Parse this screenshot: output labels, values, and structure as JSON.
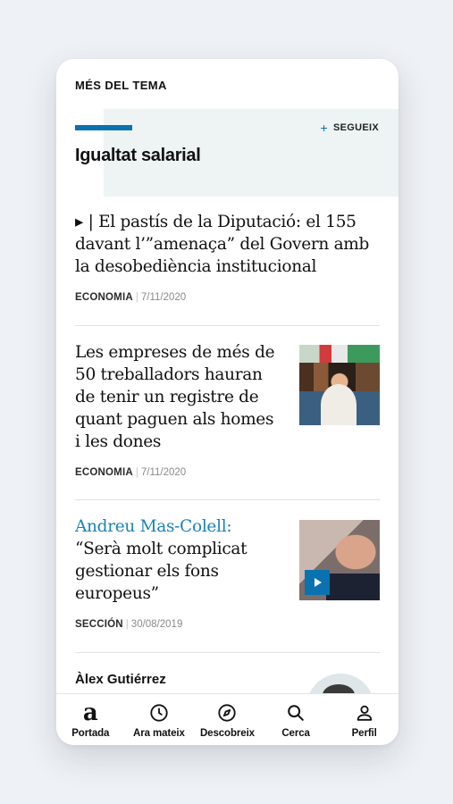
{
  "section": {
    "label": "MÉS DEL TEMA"
  },
  "topic": {
    "title": "Igualtat salarial",
    "follow_label": "SEGUEIX",
    "follow_icon": "plus-icon",
    "accent": "#0a72ae"
  },
  "articles": [
    {
      "headline_prefix": "▸ | ",
      "headline": "El pastís de la Diputació: el 155 davant l’”amenaça” del Govern amb la desobediència institucional",
      "category": "ECONOMIA",
      "date": "7/11/2020"
    },
    {
      "headline": "Les empreses de més de 50 treballadors hauran de tenir un registre de quant paguen als homes i les dones",
      "category": "ECONOMIA",
      "date": "7/11/2020",
      "image": "factory-worker-photo"
    },
    {
      "headline_accent": "Andreu Mas-Colell:",
      "headline": "“Serà molt complicat gestionar els fons europeus”",
      "category": "SECCIÓN",
      "date": "30/08/2019",
      "image": "interview-video-photo",
      "video_icon": "play-icon"
    }
  ],
  "author": {
    "name": "Àlex Gutiérrez"
  },
  "tabbar": {
    "items": [
      {
        "label": "Portada",
        "icon": "logo-a-icon"
      },
      {
        "label": "Ara mateix",
        "icon": "clock-icon"
      },
      {
        "label": "Descobreix",
        "icon": "compass-icon"
      },
      {
        "label": "Cerca",
        "icon": "search-icon"
      },
      {
        "label": "Perfil",
        "icon": "user-icon"
      }
    ]
  }
}
